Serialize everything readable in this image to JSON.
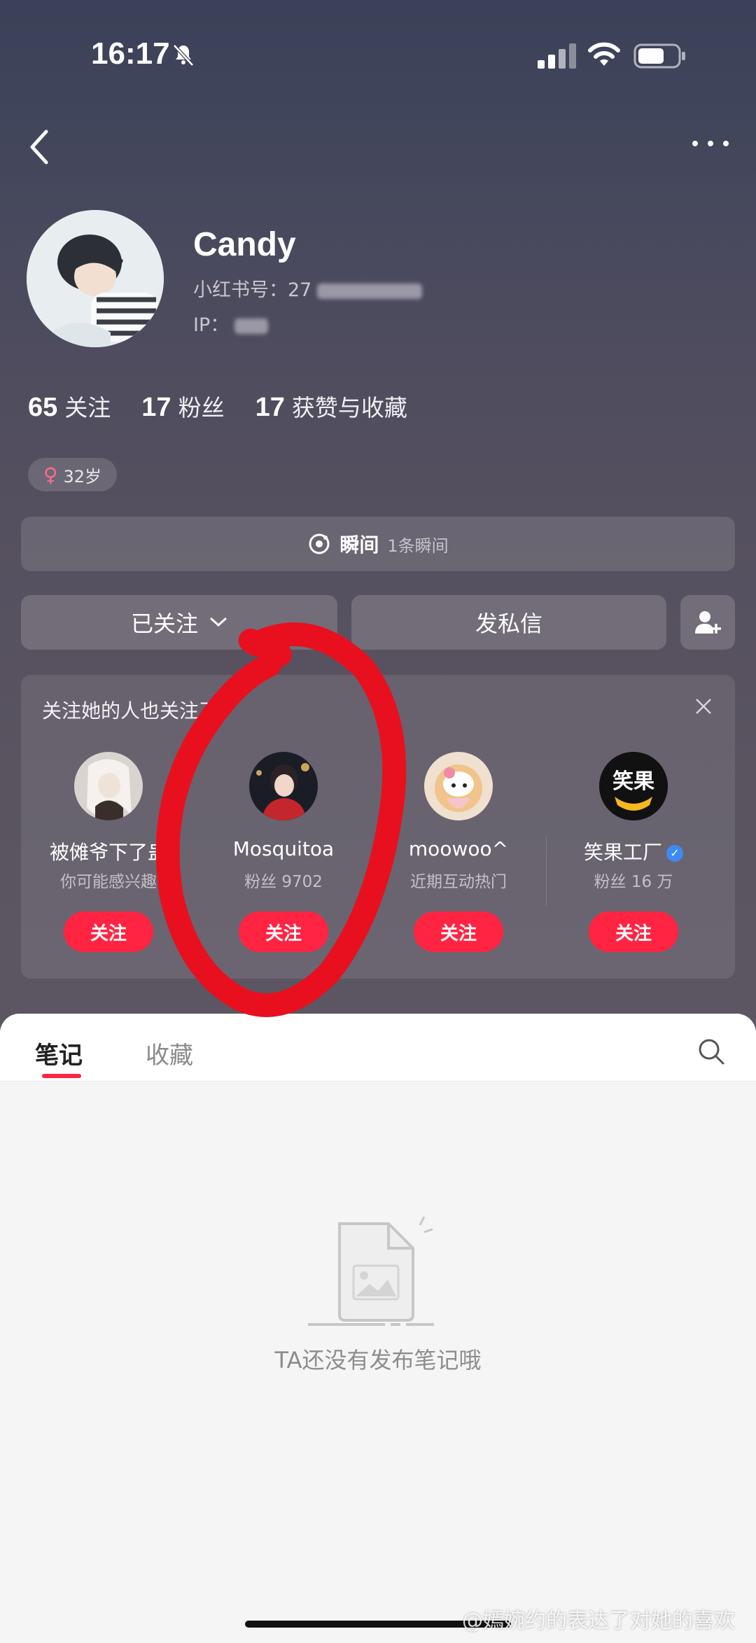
{
  "status_bar": {
    "time": "16:17"
  },
  "profile": {
    "name": "Candy",
    "id_label": "小红书号：",
    "id_visible": "27",
    "ip_label": "IP：",
    "stats": [
      {
        "num": "65",
        "label": "关注"
      },
      {
        "num": "17",
        "label": "粉丝"
      },
      {
        "num": "17",
        "label": "获赞与收藏"
      }
    ],
    "age_symbol": "♀",
    "age": "32岁"
  },
  "moment": {
    "title": "瞬间",
    "count": "1条瞬间"
  },
  "actions": {
    "followed": "已关注",
    "message": "发私信"
  },
  "recommend": {
    "title": "关注她的人也关注了",
    "users": [
      {
        "name": "被傩爷下了蛊",
        "sub": "你可能感兴趣",
        "button": "关注"
      },
      {
        "name": "Mosquitoa",
        "sub": "粉丝 9702",
        "button": "关注"
      },
      {
        "name": "moowoo^",
        "sub": "近期互动热门",
        "button": "关注"
      },
      {
        "name": "笑果工厂",
        "sub": "粉丝 16 万",
        "button": "关注",
        "logo_text": "笑果"
      }
    ]
  },
  "tabs": {
    "notes": "笔记",
    "favorites": "收藏"
  },
  "empty_state": "TA还没有发布笔记哦",
  "watermark": "@嫣婉约的表达了对她的喜欢",
  "colors": {
    "accent": "#ff2442",
    "annotation": "#e8101f",
    "verified": "#3d8bf2"
  }
}
